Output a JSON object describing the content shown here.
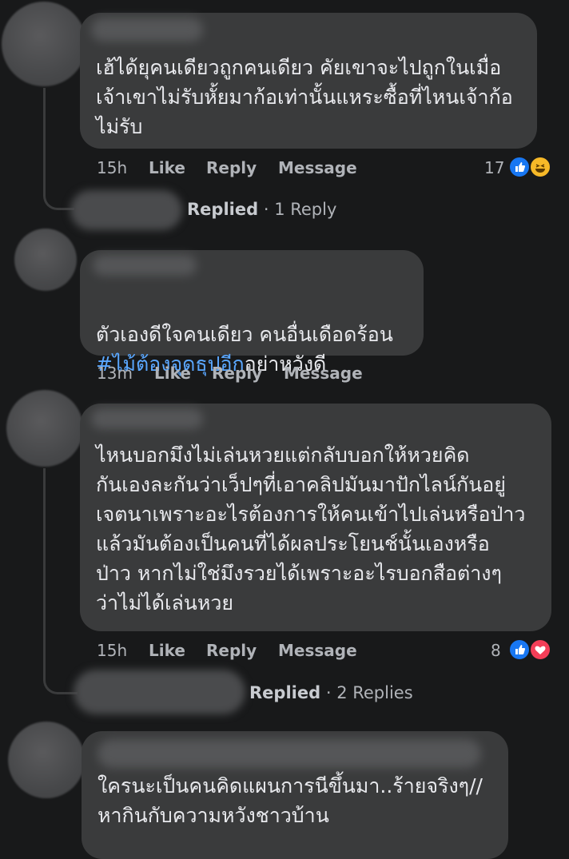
{
  "comments": [
    {
      "text": "เฮ้ได้ยุคนเดียวถูกคนเดียว คัยเขาจะไปถูกในเมื่อ\nเจ้าเขาไม่รับหั้ยมาก้อเท่านั้นแหระซื้อที่ไหนเจ้าก้อ\nไม่รับ",
      "time": "15h",
      "like": "Like",
      "reply": "Reply",
      "message": "Message",
      "reaction_count": "17",
      "reaction_icons": [
        "like-icon",
        "haha-icon"
      ],
      "replied": "Replied",
      "reply_count": "1 Reply"
    },
    {
      "text": "ตัวเองดีใจคนเดียว คนอื่นเดือดร้อน",
      "hashtag": "#ไม้ต้องจุดธุปอีก",
      "text_after_hashtag": "อย่าหวังดี",
      "time": "13m",
      "like": "Like",
      "reply": "Reply",
      "message": "Message"
    },
    {
      "text": "ไหนบอกมึงไม่เล่นหวยแต่กลับบอกให้หวยคิด\nกันเองละกันว่าเว็ปๆที่เอาคลิปมันมาปักไลน์กันอยู่\nเจตนาเพราะอะไรต้องการให้คนเข้าไปเล่นหรือป่าว\nแล้วมันต้องเป็นคนที่ได้ผลประโยนช์นั้นเองหรือ\nป่าว หากไม่ใช่มึงรวยได้เพราะอะไรบอกสือต่างๆ\nว่าไม่ได้เล่นหวย",
      "time": "15h",
      "like": "Like",
      "reply": "Reply",
      "message": "Message",
      "reaction_count": "8",
      "reaction_icons": [
        "like-icon",
        "love-icon"
      ],
      "replied": "Replied",
      "reply_count": "2 Replies"
    },
    {
      "text": "ใครนะเป็นคนคิดแผนการนีขึ้นมา..ร้ายจริงๆ//\nหากินกับความหวังชาวบ้าน"
    }
  ],
  "separator": "·",
  "colors": {
    "background": "#18191a",
    "bubble": "#3a3b3c",
    "hashtag": "#5aa7ff",
    "like": "#1877f2",
    "love": "#f33e58",
    "haha": "#f7b928"
  }
}
